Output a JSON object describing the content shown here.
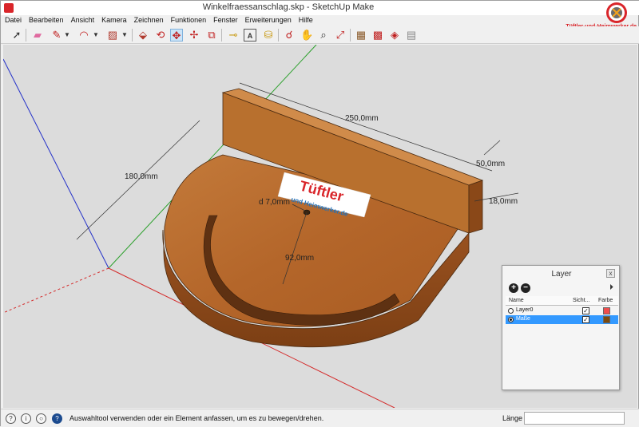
{
  "window": {
    "title": "Winkelfraessanschlag.skp - SketchUp Make"
  },
  "brand": {
    "text": "Tüftler-und-Heimwerker.de"
  },
  "menu": {
    "items": [
      "Datei",
      "Bearbeiten",
      "Ansicht",
      "Kamera",
      "Zeichnen",
      "Funktionen",
      "Fenster",
      "Erweiterungen",
      "Hilfe"
    ]
  },
  "toolbar": {
    "tools": [
      {
        "name": "select-icon",
        "glyph": "➚"
      },
      {
        "name": "eraser-icon",
        "glyph": "▰"
      },
      {
        "name": "pencil-icon",
        "glyph": "✎"
      },
      {
        "name": "arc-icon",
        "glyph": "◠"
      },
      {
        "name": "shapes-icon",
        "glyph": "▨"
      },
      {
        "name": "push-pull-icon",
        "glyph": "⬙"
      },
      {
        "name": "follow-me-icon",
        "glyph": "⟲"
      },
      {
        "name": "move-icon",
        "glyph": "✥"
      },
      {
        "name": "rotate-icon",
        "glyph": "✢"
      },
      {
        "name": "scale-icon",
        "glyph": "⧉"
      },
      {
        "name": "tape-measure-icon",
        "glyph": "⊸"
      },
      {
        "name": "text-icon",
        "glyph": "A"
      },
      {
        "name": "paint-bucket-icon",
        "glyph": "⛁"
      },
      {
        "name": "orbit-icon",
        "glyph": "☌"
      },
      {
        "name": "pan-icon",
        "glyph": "✋"
      },
      {
        "name": "zoom-icon",
        "glyph": "⌕"
      },
      {
        "name": "zoom-extents-icon",
        "glyph": "⤢"
      },
      {
        "name": "warehouse-icon",
        "glyph": "▦"
      },
      {
        "name": "extension-warehouse-icon",
        "glyph": "▩"
      },
      {
        "name": "components-icon",
        "glyph": "◈"
      },
      {
        "name": "send-to-layout-icon",
        "glyph": "▤"
      }
    ]
  },
  "model": {
    "labels": {
      "width": "250,0mm",
      "depth": "180,0mm",
      "height": "50,0mm",
      "thickness": "18,0mm",
      "hole": "d 7,0mm",
      "radius": "92,0mm"
    },
    "logo": {
      "line1": "Tüftler",
      "line2": "und Heimwerker.de"
    }
  },
  "layer_panel": {
    "title": "Layer",
    "detail_glyph": "⏵",
    "columns": {
      "name": "Name",
      "visible": "Sicht...",
      "color": "Farbe"
    },
    "rows": [
      {
        "name": "Layer0",
        "active": false,
        "visible": true,
        "color": "#ef4d4d"
      },
      {
        "name": "Maße",
        "active": true,
        "visible": true,
        "color": "#7a4a10"
      }
    ]
  },
  "status": {
    "text": "Auswahltool verwenden oder ein Element anfassen, um es zu bewegen/drehen.",
    "measure_label": "Länge",
    "measure_value": ""
  }
}
